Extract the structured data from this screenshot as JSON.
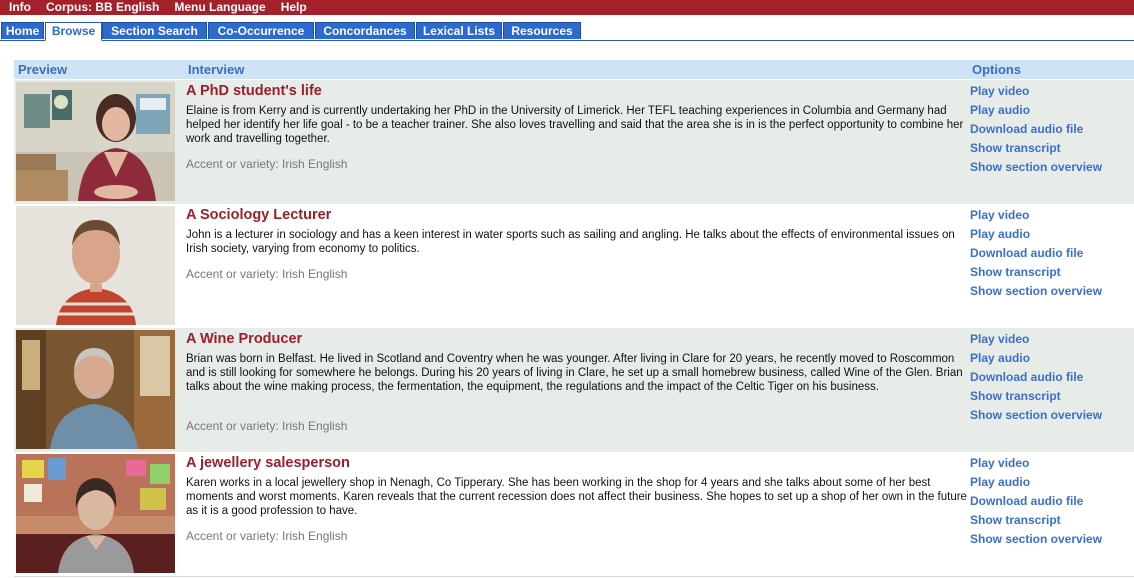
{
  "menu": [
    "Info",
    "Corpus: BB English",
    "Menu Language",
    "Help"
  ],
  "tabs": [
    {
      "label": "Home"
    },
    {
      "label": "Browse",
      "active": true
    },
    {
      "label": "Section Search"
    },
    {
      "label": "Co-Occurrence"
    },
    {
      "label": "Concordances"
    },
    {
      "label": "Lexical Lists"
    },
    {
      "label": "Resources"
    }
  ],
  "table_header": {
    "preview": "Preview",
    "interview": "Interview",
    "options": "Options"
  },
  "options_labels": [
    "Play video",
    "Play audio",
    "Download audio file",
    "Show transcript",
    "Show section overview"
  ],
  "interviews": [
    {
      "title": "A PhD student's life",
      "description": "Elaine is from Kerry and is currently undertaking her PhD in the University of Limerick. Her TEFL teaching experiences in Columbia and Germany had helped her identify her life goal - to be a teacher trainer. She also loves travelling and said that the area she is in is the perfect opportunity to combine her work and travelling together.",
      "accent": "Accent or variety: Irish English"
    },
    {
      "title": "A Sociology Lecturer",
      "description": "John is a lecturer in sociology and has a keen interest in water sports such as sailing and angling. He talks about the effects of environmental issues on Irish society, varying from economy to politics.",
      "accent": "Accent or variety: Irish English"
    },
    {
      "title": "A Wine Producer",
      "description": "Brian was born in Belfast. He lived in Scotland and Coventry when he was younger. After living in Clare for 20 years, he recently moved to Roscommon and is still looking for somewhere he belongs. During his 20 years of living in Clare, he set up a small homebrew business, called Wine of the Glen. Brian talks about the wine making process, the fermentation, the equipment, the regulations and the impact of the Celtic Tiger on his business.",
      "accent": "Accent or variety: Irish English"
    },
    {
      "title": "A jewellery salesperson",
      "description": "Karen works in a local jewellery shop in Nenagh, Co Tipperary. She has been working in the shop for 4 years and she talks about some of her best moments and worst moments. Karen reveals that the current recession does not affect their business. She hopes to set up a shop of her own in the future as it is a good profession to have.",
      "accent": "Accent or variety: Irish English"
    }
  ],
  "colors": {
    "menu_bar": "#a4202b",
    "tab": "#2c6ad0",
    "title": "#9b1f2b",
    "link": "#3a6fd0",
    "header_bg": "#cfe3f7",
    "row_shade": "#e8ece8"
  }
}
